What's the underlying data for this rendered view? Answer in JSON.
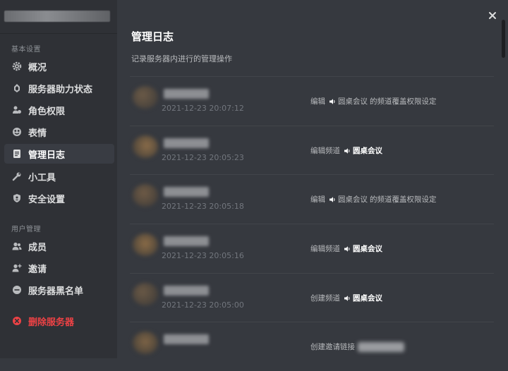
{
  "sidebar": {
    "sections": [
      {
        "header": "基本设置",
        "items": [
          {
            "label": "概况",
            "icon": "gear-icon"
          },
          {
            "label": "服务器助力状态",
            "icon": "boost-icon"
          },
          {
            "label": "角色权限",
            "icon": "roles-icon"
          },
          {
            "label": "表情",
            "icon": "emoji-icon"
          },
          {
            "label": "管理日志",
            "icon": "audit-log-icon",
            "selected": true
          },
          {
            "label": "小工具",
            "icon": "wrench-icon"
          },
          {
            "label": "安全设置",
            "icon": "shield-icon"
          }
        ]
      },
      {
        "header": "用户管理",
        "items": [
          {
            "label": "成员",
            "icon": "members-icon"
          },
          {
            "label": "邀请",
            "icon": "invite-icon"
          },
          {
            "label": "服务器黑名单",
            "icon": "ban-icon"
          }
        ]
      }
    ],
    "delete_label": "删除服务器"
  },
  "main": {
    "title": "管理日志",
    "subtitle": "记录服务器内进行的管理操作",
    "log_entries": [
      {
        "timestamp": "2021-12-23 20:07:12",
        "action": "编辑",
        "channel": "圆桌会议",
        "suffix": "的频道覆盖权限设定"
      },
      {
        "timestamp": "2021-12-23 20:05:23",
        "action": "编辑频道",
        "channel": "圆桌会议",
        "suffix": ""
      },
      {
        "timestamp": "2021-12-23 20:05:18",
        "action": "编辑",
        "channel": "圆桌会议",
        "suffix": "的频道覆盖权限设定"
      },
      {
        "timestamp": "2021-12-23 20:05:16",
        "action": "编辑频道",
        "channel": "圆桌会议",
        "suffix": ""
      },
      {
        "timestamp": "2021-12-23 20:05:00",
        "action": "创建频道",
        "channel": "圆桌会议",
        "suffix": ""
      },
      {
        "timestamp": "",
        "action": "创建邀请链接",
        "channel": "",
        "suffix": ""
      }
    ]
  },
  "colors": {
    "background": "#36393f",
    "sidebar": "#2f3136",
    "selected": "#393c43",
    "danger": "#ed4245"
  }
}
